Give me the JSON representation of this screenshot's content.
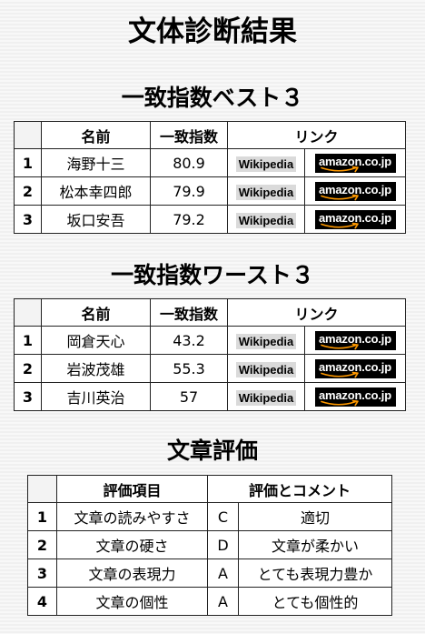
{
  "page": {
    "title": "文体診断結果"
  },
  "links": {
    "wikipedia_label": "Wikipedia",
    "amazon_label": "amazon.co.jp"
  },
  "best": {
    "heading": "一致指数ベスト３",
    "headers": {
      "name": "名前",
      "score": "一致指数",
      "links": "リンク"
    },
    "rows": [
      {
        "rank": "1",
        "name": "海野十三",
        "score": "80.9"
      },
      {
        "rank": "2",
        "name": "松本幸四郎",
        "score": "79.9"
      },
      {
        "rank": "3",
        "name": "坂口安吾",
        "score": "79.2"
      }
    ]
  },
  "worst": {
    "heading": "一致指数ワースト３",
    "headers": {
      "name": "名前",
      "score": "一致指数",
      "links": "リンク"
    },
    "rows": [
      {
        "rank": "1",
        "name": "岡倉天心",
        "score": "43.2"
      },
      {
        "rank": "2",
        "name": "岩波茂雄",
        "score": "55.3"
      },
      {
        "rank": "3",
        "name": "吉川英治",
        "score": "57"
      }
    ]
  },
  "evaluation": {
    "heading": "文章評価",
    "headers": {
      "item": "評価項目",
      "comment": "評価とコメント"
    },
    "rows": [
      {
        "no": "1",
        "item": "文章の読みやすさ",
        "grade": "C",
        "comment": "適切"
      },
      {
        "no": "2",
        "item": "文章の硬さ",
        "grade": "D",
        "comment": "文章が柔かい"
      },
      {
        "no": "3",
        "item": "文章の表現力",
        "grade": "A",
        "comment": "とても表現力豊か"
      },
      {
        "no": "4",
        "item": "文章の個性",
        "grade": "A",
        "comment": "とても個性的"
      }
    ]
  },
  "colors": {
    "text": "#000000",
    "border": "#222222",
    "wiki_button_bg": "#DADADA",
    "amazon_bg": "#000000",
    "amazon_text": "#FFFFFF",
    "amazon_orange": "#FF9900"
  }
}
